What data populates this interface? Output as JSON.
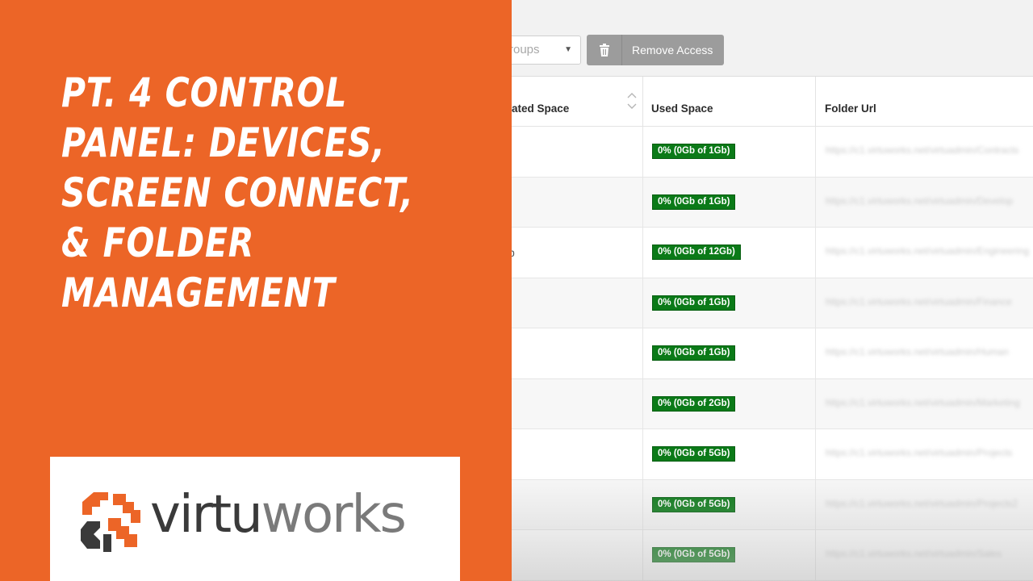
{
  "title": {
    "lines": [
      "Pt. 4 Control",
      "Panel: Devices,",
      "Screen Connect,",
      "& Folder",
      "Management"
    ]
  },
  "logo": {
    "text_part1": "virtu",
    "text_part2": "works",
    "brand_orange": "#ec6527",
    "brand_dark": "#3a3a3a"
  },
  "toolbar": {
    "groups_select_value": "roups",
    "remove_access_label": "Remove Access"
  },
  "table": {
    "columns": [
      "ated Space",
      "Used Space",
      "Folder Url"
    ],
    "rows": [
      {
        "allocated": "",
        "used": "0% (0Gb of 1Gb)",
        "url": "https://c1.virtuworks.net/virtuadmin/Contracts"
      },
      {
        "allocated": "",
        "used": "0% (0Gb of 1Gb)",
        "url": "https://c1.virtuworks.net/virtuadmin/Develop"
      },
      {
        "allocated": "b",
        "used": "0% (0Gb of 12Gb)",
        "url": "https://c1.virtuworks.net/virtuadmin/Engineering"
      },
      {
        "allocated": "",
        "used": "0% (0Gb of 1Gb)",
        "url": "https://c1.virtuworks.net/virtuadmin/Finance"
      },
      {
        "allocated": "",
        "used": "0% (0Gb of 1Gb)",
        "url": "https://c1.virtuworks.net/virtuadmin/Human"
      },
      {
        "allocated": "",
        "used": "0% (0Gb of 2Gb)",
        "url": "https://c1.virtuworks.net/virtuadmin/Marketing"
      },
      {
        "allocated": "",
        "used": "0% (0Gb of 5Gb)",
        "url": "https://c1.virtuworks.net/virtuadmin/Projects"
      },
      {
        "allocated": "",
        "used": "0% (0Gb of 5Gb)",
        "url": "https://c1.virtuworks.net/virtuadmin/Projects2"
      },
      {
        "allocated": "",
        "used": "0% (0Gb of 5Gb)",
        "url": "https://c1.virtuworks.net/virtuadmin/Sales"
      }
    ]
  },
  "colors": {
    "badge_green": "#0b7a18",
    "button_gray": "#9c9c9c"
  },
  "icons": {
    "trash": "trash-icon",
    "sort": "sort-icon",
    "caret": "caret-down-icon",
    "logo": "virtuworks-logo-icon"
  }
}
